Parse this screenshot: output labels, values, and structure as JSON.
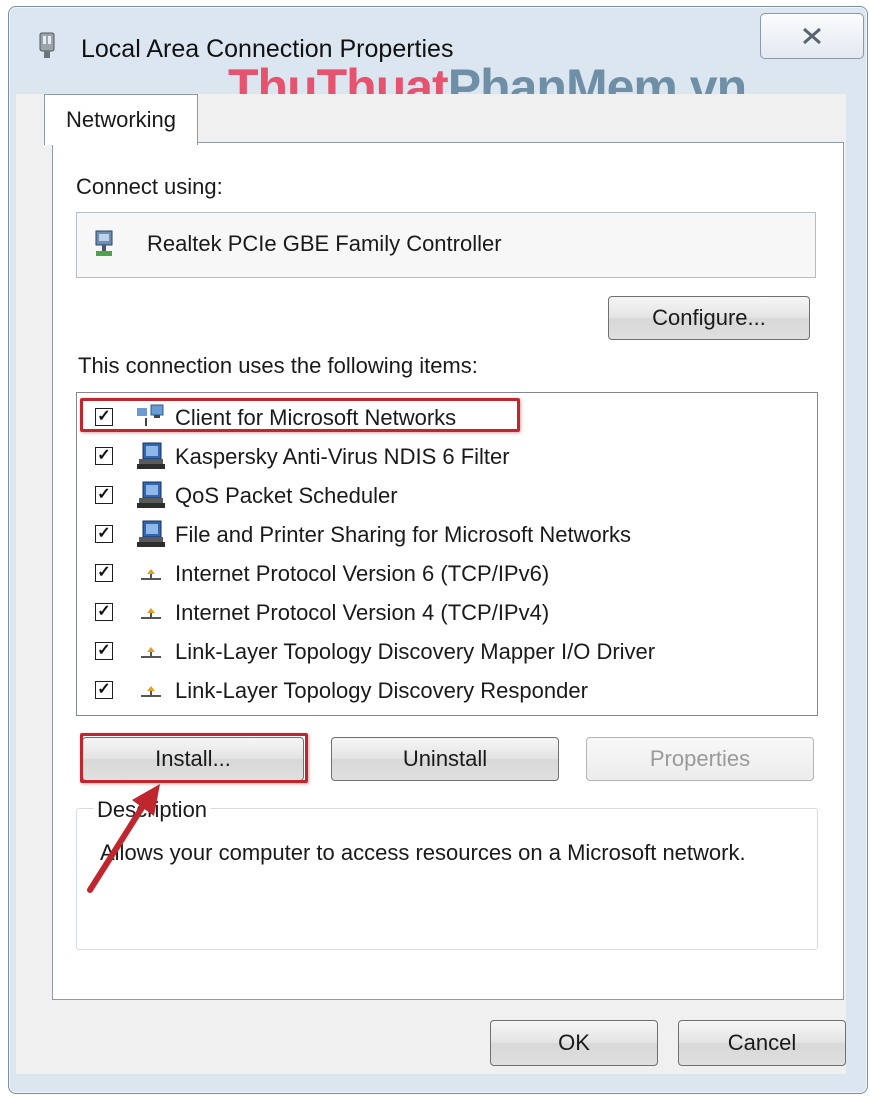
{
  "window": {
    "title": "Local Area Connection Properties",
    "close_glyph": "✕"
  },
  "watermark": {
    "part1": "ThuThuat",
    "part2": "PhanMem.vn"
  },
  "tabs": [
    {
      "label": "Networking"
    }
  ],
  "connect_using": {
    "label": "Connect using:",
    "adapter": "Realtek PCIe GBE Family Controller"
  },
  "configure_button": "Configure...",
  "items_label": "This connection uses the following items:",
  "items": [
    {
      "label": "Client for Microsoft Networks",
      "checked": true,
      "icon": "network-client-icon"
    },
    {
      "label": "Kaspersky Anti-Virus NDIS 6 Filter",
      "checked": true,
      "icon": "network-service-icon"
    },
    {
      "label": "QoS Packet Scheduler",
      "checked": true,
      "icon": "network-service-icon"
    },
    {
      "label": "File and Printer Sharing for Microsoft Networks",
      "checked": true,
      "icon": "network-service-icon"
    },
    {
      "label": "Internet Protocol Version 6 (TCP/IPv6)",
      "checked": true,
      "icon": "protocol-icon"
    },
    {
      "label": "Internet Protocol Version 4 (TCP/IPv4)",
      "checked": true,
      "icon": "protocol-icon"
    },
    {
      "label": "Link-Layer Topology Discovery Mapper I/O Driver",
      "checked": true,
      "icon": "protocol-icon"
    },
    {
      "label": "Link-Layer Topology Discovery Responder",
      "checked": true,
      "icon": "protocol-icon"
    }
  ],
  "actions": {
    "install": "Install...",
    "uninstall": "Uninstall",
    "properties": "Properties"
  },
  "description": {
    "title": "Description",
    "text": "Allows your computer to access resources on a Microsoft network."
  },
  "footer": {
    "ok": "OK",
    "cancel": "Cancel"
  },
  "colors": {
    "highlight": "#c0262d",
    "window_frame": "#dce6f1"
  }
}
